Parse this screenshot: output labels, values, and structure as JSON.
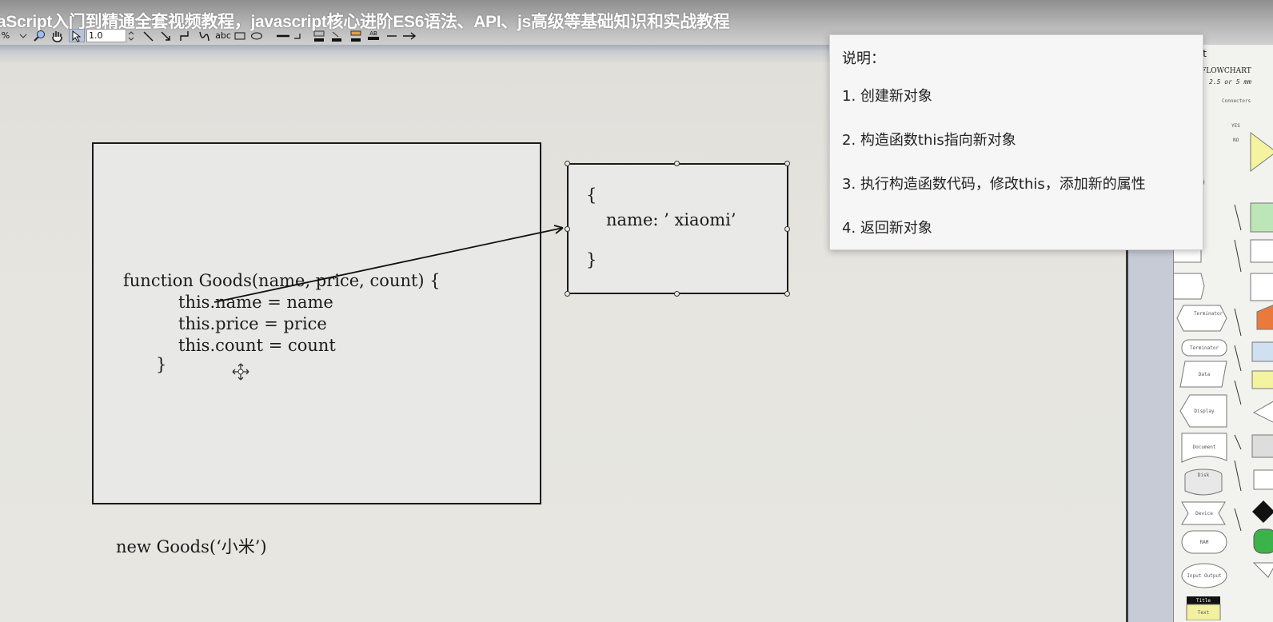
{
  "video_title": "aScript入门到精通全套视频教程，javascript核心进阶ES6语法、API、js高级等基础知识和实战教程",
  "toolbar": {
    "zoom_fragment": "%",
    "line_width": "1.0",
    "text_tool_label": "abc",
    "text_color_label": "AB",
    "tools": [
      "zoom-tool",
      "hand-tool",
      "pointer-tool",
      "line-tool",
      "arrow-line-tool",
      "elbow-tool",
      "curve-tool",
      "text-tool",
      "rectangle-tool",
      "ellipse-tool",
      "line-style",
      "line-end-style",
      "fill-color",
      "line-color",
      "text-color",
      "line-pattern",
      "arrow-style"
    ]
  },
  "diagram": {
    "code_lines": [
      "function Goods(name, price, count) {",
      "this.name = name",
      "this.price = price",
      "this.count = count",
      "}"
    ],
    "object_lines": [
      "{",
      "name: ’ xiaomi’",
      "}"
    ],
    "call_text": "new Goods(‘小米’)"
  },
  "right_panel": {
    "header": "art",
    "stencil_title": "FLOWCHART",
    "stencil_subtitle": "2.5 or 5 mm",
    "shapes": [
      "Connectors",
      "YES",
      "NO",
      "Terminator",
      "Terminator",
      "Data",
      "Display",
      "Document",
      "Disk",
      "Device",
      "RAM",
      "Input Output",
      "Title",
      "Text"
    ]
  },
  "note": {
    "title": "说明：",
    "items": [
      "1. 创建新对象",
      "2. 构造函数this指向新对象",
      "3. 执行构造函数代码，修改this，添加新的属性",
      "4. 返回新对象"
    ]
  }
}
